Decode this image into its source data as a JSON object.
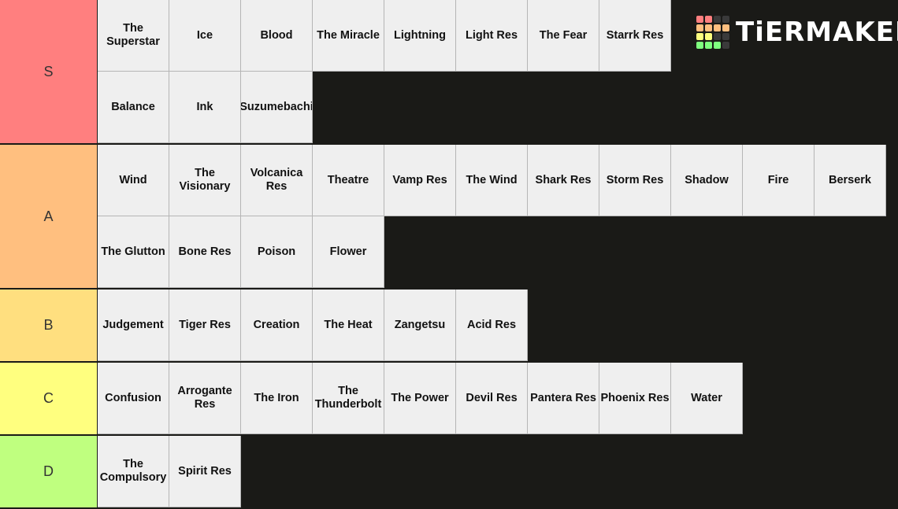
{
  "logo": {
    "text": "TiERMAKER",
    "grid_colors": [
      "#ff7f7f",
      "#ff7f7f",
      "#3a3a3a",
      "#3a3a3a",
      "#ffbf7f",
      "#ffbf7f",
      "#ffbf7f",
      "#ffbf7f",
      "#ffff7f",
      "#ffff7f",
      "#3a3a3a",
      "#3a3a3a",
      "#7fff7f",
      "#7fff7f",
      "#7fff7f",
      "#3a3a3a"
    ]
  },
  "tiers": [
    {
      "label": "S",
      "color": "#ff7f7f",
      "items": [
        "The Superstar",
        "Ice",
        "Blood",
        "The Miracle",
        "Lightning",
        "Light Res",
        "The Fear",
        "Starrk Res",
        "Balance",
        "Ink",
        "Suzumebachi"
      ],
      "row_capacity": 8
    },
    {
      "label": "A",
      "color": "#ffbf7f",
      "items": [
        "Wind",
        "The Visionary",
        "Volcanica Res",
        "Theatre",
        "Vamp Res",
        "The Wind",
        "Shark Res",
        "Storm Res",
        "Shadow",
        "Fire",
        "Berserk",
        "The Glutton",
        "Bone Res",
        "Poison",
        "Flower"
      ],
      "row_capacity": 11
    },
    {
      "label": "B",
      "color": "#ffdf7f",
      "items": [
        "Judgement",
        "Tiger Res",
        "Creation",
        "The Heat",
        "Zangetsu",
        "Acid Res"
      ],
      "row_capacity": 11
    },
    {
      "label": "C",
      "color": "#ffff7f",
      "items": [
        "Confusion",
        "Arrogante Res",
        "The Iron",
        "The Thunderbolt",
        "The Power",
        "Devil Res",
        "Pantera Res",
        "Phoenix Res",
        "Water"
      ],
      "row_capacity": 11
    },
    {
      "label": "D",
      "color": "#bfff7f",
      "items": [
        "The Compulsory",
        "Spirit Res"
      ],
      "row_capacity": 11
    }
  ]
}
